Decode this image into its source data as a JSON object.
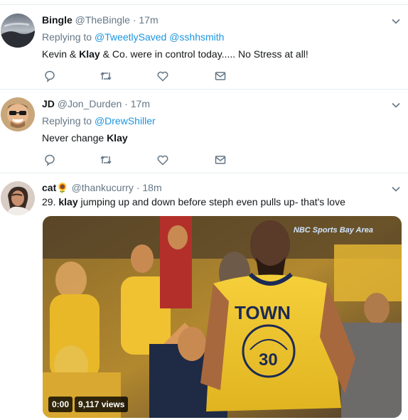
{
  "tweets": [
    {
      "name": "Bingle",
      "handle": "@TheBingle",
      "sep": "·",
      "time": "17m",
      "replying_prefix": "Replying to",
      "mentions": [
        "@TweetlySaved",
        "@sshhsmith"
      ],
      "text_before": "Kevin & ",
      "text_bold": "Klay",
      "text_after": " & Co. were in control today..... No Stress at all!"
    },
    {
      "name": "JD",
      "handle": "@Jon_Durden",
      "sep": "·",
      "time": "17m",
      "replying_prefix": "Replying to",
      "mentions": [
        "@DrewShiller"
      ],
      "text_before": "Never change ",
      "text_bold": "Klay",
      "text_after": ""
    },
    {
      "name": "cat",
      "name_emoji": "🌻",
      "handle": "@thankucurry",
      "sep": "·",
      "time": "18m",
      "text_before": "29. ",
      "text_bold": "klay",
      "text_after": " jumping up and down before steph even pulls up- that's love",
      "media": {
        "duration": "0:00",
        "views": "9,117 views",
        "jersey_text": "TOWN",
        "jersey_number": "30",
        "broadcaster_logo": "NBC Sports Bay Area"
      }
    }
  ],
  "icons": {
    "reply": "reply-icon",
    "retweet": "retweet-icon",
    "like": "heart-icon",
    "dm": "envelope-icon",
    "menu": "chevron-down-icon"
  },
  "colors": {
    "link": "#1b95e0",
    "secondary": "#657786",
    "divider": "#e6ecf0"
  }
}
